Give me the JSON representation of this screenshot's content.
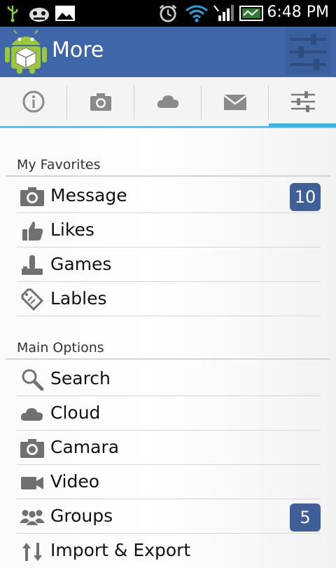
{
  "status_bar": {
    "time": "6:48 PM",
    "icons": [
      "usb-icon",
      "bug-icon",
      "image-icon",
      "alarm-icon",
      "wifi-icon",
      "signal-icon",
      "battery-icon"
    ]
  },
  "action_bar": {
    "title": "More",
    "logo_icon": "android-logo",
    "settings_icon": "sliders-icon",
    "color": "#3f66a8"
  },
  "tabs": [
    {
      "icon": "info-icon",
      "active": false
    },
    {
      "icon": "camera-icon",
      "active": false
    },
    {
      "icon": "cloud-icon",
      "active": false
    },
    {
      "icon": "mail-icon",
      "active": false
    },
    {
      "icon": "sliders-icon",
      "active": true
    }
  ],
  "accent_color": "#33b5e5",
  "sections": [
    {
      "title": "My Favorites",
      "items": [
        {
          "label": "Message",
          "icon": "camera-icon",
          "badge": "10"
        },
        {
          "label": "Likes",
          "icon": "thumbs-up-icon"
        },
        {
          "label": "Games",
          "icon": "joystick-icon"
        },
        {
          "label": "Lables",
          "icon": "tag-icon"
        }
      ]
    },
    {
      "title": "Main Options",
      "items": [
        {
          "label": "Search",
          "icon": "search-icon"
        },
        {
          "label": "Cloud",
          "icon": "cloud-icon"
        },
        {
          "label": "Camara",
          "icon": "camera-icon"
        },
        {
          "label": "Video",
          "icon": "video-icon"
        },
        {
          "label": "Groups",
          "icon": "group-icon",
          "badge": "5"
        },
        {
          "label": "Import & Export",
          "icon": "import-export-icon"
        }
      ]
    }
  ],
  "badge_color": "#3f5f99"
}
